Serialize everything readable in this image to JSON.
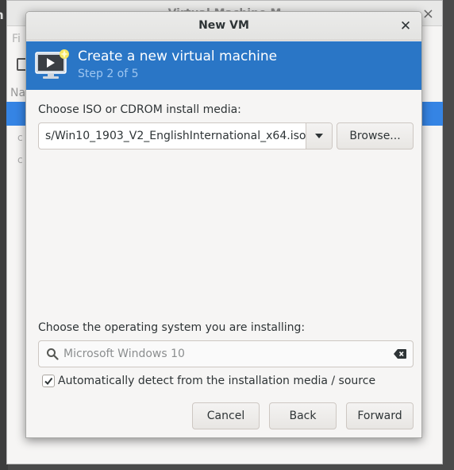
{
  "background": {
    "title": "Virtual Machine M",
    "menu_label": "Fi",
    "left_label": "h",
    "column_label": "Na"
  },
  "dialog": {
    "title": "New VM",
    "banner_title": "Create a new virtual machine",
    "banner_step": "Step 2 of 5",
    "media_label": "Choose ISO or CDROM install media:",
    "media_value": "s/Win10_1903_V2_EnglishInternational_x64.iso",
    "browse_label": "Browse...",
    "os_label": "Choose the operating system you are installing:",
    "os_value": "Microsoft Windows 10",
    "auto_detect_label": "Automatically detect from the installation media / source",
    "auto_detect_checked": true,
    "cancel_label": "Cancel",
    "back_label": "Back",
    "forward_label": "Forward"
  },
  "icons": {
    "banner": "vm-monitor-new-icon",
    "combo": "chevron-down-icon",
    "search": "search-icon",
    "clear": "clear-icon",
    "close": "close-icon"
  },
  "colors": {
    "banner": "#2a76c6",
    "banner_step": "#9ec6f0",
    "selection": "#3584e4"
  }
}
